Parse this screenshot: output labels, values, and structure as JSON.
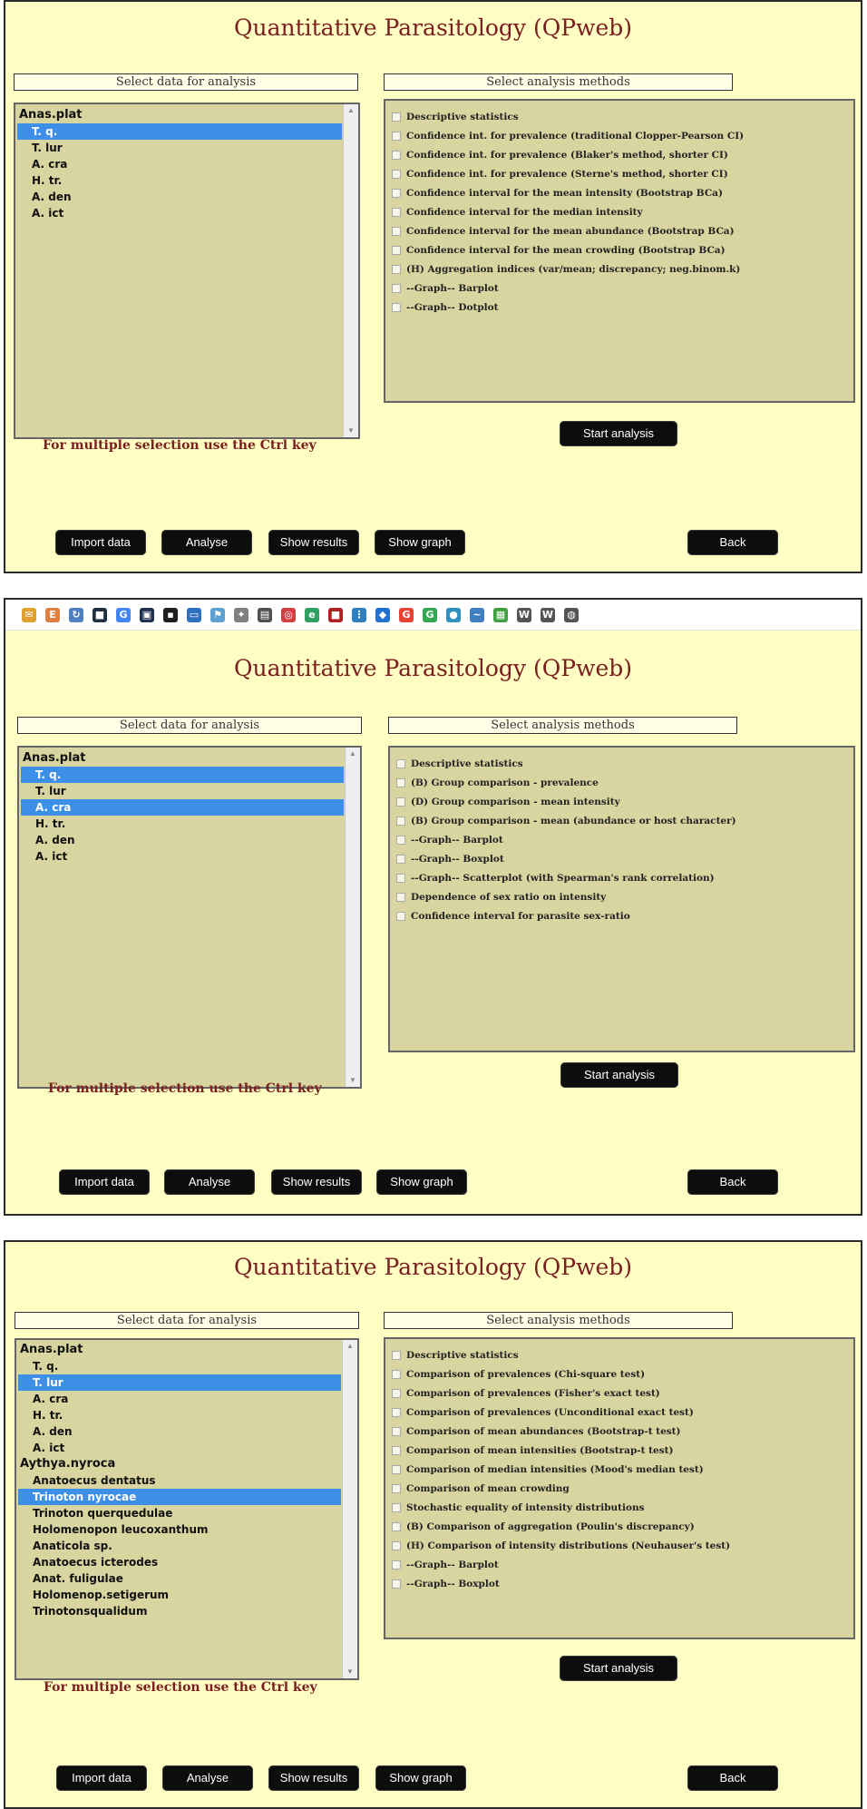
{
  "app_title": "Quantitative Parasitology (QPweb)",
  "data_header": "Select data for analysis",
  "methods_header": "Select analysis methods",
  "multi_select_note": "For multiple selection use the Ctrl key",
  "buttons": {
    "start_analysis": "Start analysis",
    "import_data": "Import data",
    "analyse": "Analyse",
    "show_results": "Show results",
    "show_graph": "Show graph",
    "back": "Back"
  },
  "bookmarks": [
    {
      "icon": "envelope-icon",
      "glyph": "✉",
      "color": "#e0a030"
    },
    {
      "icon": "letter-e-icon",
      "glyph": "E",
      "color": "#e08040"
    },
    {
      "icon": "refresh-icon",
      "glyph": "↻",
      "color": "#5080c0"
    },
    {
      "icon": "dark-square-icon",
      "glyph": "■",
      "color": "#203040"
    },
    {
      "icon": "google-icon",
      "glyph": "G",
      "color": "#4285f4"
    },
    {
      "icon": "dark-box-icon",
      "glyph": "▣",
      "color": "#203050"
    },
    {
      "icon": "black-box-icon",
      "glyph": "▪",
      "color": "#202020"
    },
    {
      "icon": "blue-window-icon",
      "glyph": "▭",
      "color": "#3070c0"
    },
    {
      "icon": "flag-icon",
      "glyph": "⚑",
      "color": "#60a0d0"
    },
    {
      "icon": "bird-icon",
      "glyph": "✦",
      "color": "#808080"
    },
    {
      "icon": "chart-icon",
      "glyph": "▤",
      "color": "#505050"
    },
    {
      "icon": "target-icon",
      "glyph": "◎",
      "color": "#d04040"
    },
    {
      "icon": "letter-e-green-icon",
      "glyph": "e",
      "color": "#30a060"
    },
    {
      "icon": "red-square-icon",
      "glyph": "■",
      "color": "#b02020"
    },
    {
      "icon": "grid-icon",
      "glyph": "⋮",
      "color": "#3080c0"
    },
    {
      "icon": "diamond-icon",
      "glyph": "◆",
      "color": "#2070d0"
    },
    {
      "icon": "google-icon",
      "glyph": "G",
      "color": "#ea4335"
    },
    {
      "icon": "google-icon",
      "glyph": "G",
      "color": "#34a853"
    },
    {
      "icon": "sphere-icon",
      "glyph": "●",
      "color": "#3090c0"
    },
    {
      "icon": "wave-icon",
      "glyph": "~",
      "color": "#4080c0"
    },
    {
      "icon": "colorful-square-icon",
      "glyph": "▦",
      "color": "#40a040"
    },
    {
      "icon": "wikipedia-icon",
      "glyph": "W",
      "color": "#555555"
    },
    {
      "icon": "wikipedia-icon",
      "glyph": "W",
      "color": "#555555"
    },
    {
      "icon": "globe-icon",
      "glyph": "◍",
      "color": "#555555"
    }
  ],
  "screens": [
    {
      "list": [
        {
          "label": "Anas.plat",
          "group": true,
          "selected": false
        },
        {
          "label": "T. q.",
          "group": false,
          "selected": true
        },
        {
          "label": "T. lur",
          "group": false,
          "selected": false
        },
        {
          "label": "A. cra",
          "group": false,
          "selected": false
        },
        {
          "label": "H. tr.",
          "group": false,
          "selected": false
        },
        {
          "label": "A. den",
          "group": false,
          "selected": false
        },
        {
          "label": "A. ict",
          "group": false,
          "selected": false
        }
      ],
      "methods": [
        "Descriptive statistics",
        "Confidence int. for prevalence (traditional Clopper-Pearson CI)",
        "Confidence int. for prevalence (Blaker's method, shorter CI)",
        "Confidence int. for prevalence (Sterne's method, shorter CI)",
        "Confidence interval for the mean intensity (Bootstrap BCa)",
        "Confidence interval for the median intensity",
        "Confidence interval for the mean abundance (Bootstrap BCa)",
        "Confidence interval for the mean crowding (Bootstrap BCa)",
        "(H) Aggregation indices (var/mean; discrepancy; neg.binom.k)",
        "--Graph-- Barplot",
        "--Graph-- Dotplot"
      ]
    },
    {
      "list": [
        {
          "label": "Anas.plat",
          "group": true,
          "selected": false
        },
        {
          "label": "T. q.",
          "group": false,
          "selected": true
        },
        {
          "label": "T. lur",
          "group": false,
          "selected": false
        },
        {
          "label": "A. cra",
          "group": false,
          "selected": true
        },
        {
          "label": "H. tr.",
          "group": false,
          "selected": false
        },
        {
          "label": "A. den",
          "group": false,
          "selected": false
        },
        {
          "label": "A. ict",
          "group": false,
          "selected": false
        }
      ],
      "methods": [
        "Descriptive statistics",
        "(B) Group comparison - prevalence",
        "(D) Group comparison - mean intensity",
        "(B) Group comparison - mean (abundance or host character)",
        "--Graph-- Barplot",
        "--Graph-- Boxplot",
        "--Graph-- Scatterplot (with Spearman's rank correlation)",
        "Dependence of sex ratio on intensity",
        "Confidence interval for parasite sex-ratio"
      ]
    },
    {
      "list": [
        {
          "label": "Anas.plat",
          "group": true,
          "selected": false
        },
        {
          "label": "T. q.",
          "group": false,
          "selected": false
        },
        {
          "label": "T. lur",
          "group": false,
          "selected": true
        },
        {
          "label": "A. cra",
          "group": false,
          "selected": false
        },
        {
          "label": "H. tr.",
          "group": false,
          "selected": false
        },
        {
          "label": "A. den",
          "group": false,
          "selected": false
        },
        {
          "label": "A. ict",
          "group": false,
          "selected": false
        },
        {
          "label": "Aythya.nyroca",
          "group": true,
          "selected": false
        },
        {
          "label": "Anatoecus dentatus",
          "group": false,
          "selected": false
        },
        {
          "label": "Trinoton nyrocae",
          "group": false,
          "selected": true
        },
        {
          "label": "Trinoton querquedulae",
          "group": false,
          "selected": false
        },
        {
          "label": "Holomenopon leucoxanthum",
          "group": false,
          "selected": false
        },
        {
          "label": "Anaticola sp.",
          "group": false,
          "selected": false
        },
        {
          "label": "Anatoecus icterodes",
          "group": false,
          "selected": false
        },
        {
          "label": "Anat. fuligulae",
          "group": false,
          "selected": false
        },
        {
          "label": "Holomenop.setigerum",
          "group": false,
          "selected": false
        },
        {
          "label": "Trinotonsqualidum",
          "group": false,
          "selected": false
        }
      ],
      "methods": [
        "Descriptive statistics",
        "Comparison of prevalences (Chi-square test)",
        "Comparison of prevalences (Fisher's exact test)",
        "Comparison of prevalences (Unconditional exact test)",
        "Comparison of mean abundances (Bootstrap-t test)",
        "Comparison of mean intensities (Bootstrap-t test)",
        "Comparison of median intensities (Mood's median test)",
        "Comparison of mean crowding",
        "Stochastic equality of intensity distributions",
        "(B) Comparison of aggregation (Poulin's discrepancy)",
        "(H) Comparison of intensity distributions (Neuhauser's test)",
        "--Graph-- Barplot",
        "--Graph-- Boxplot"
      ]
    }
  ]
}
